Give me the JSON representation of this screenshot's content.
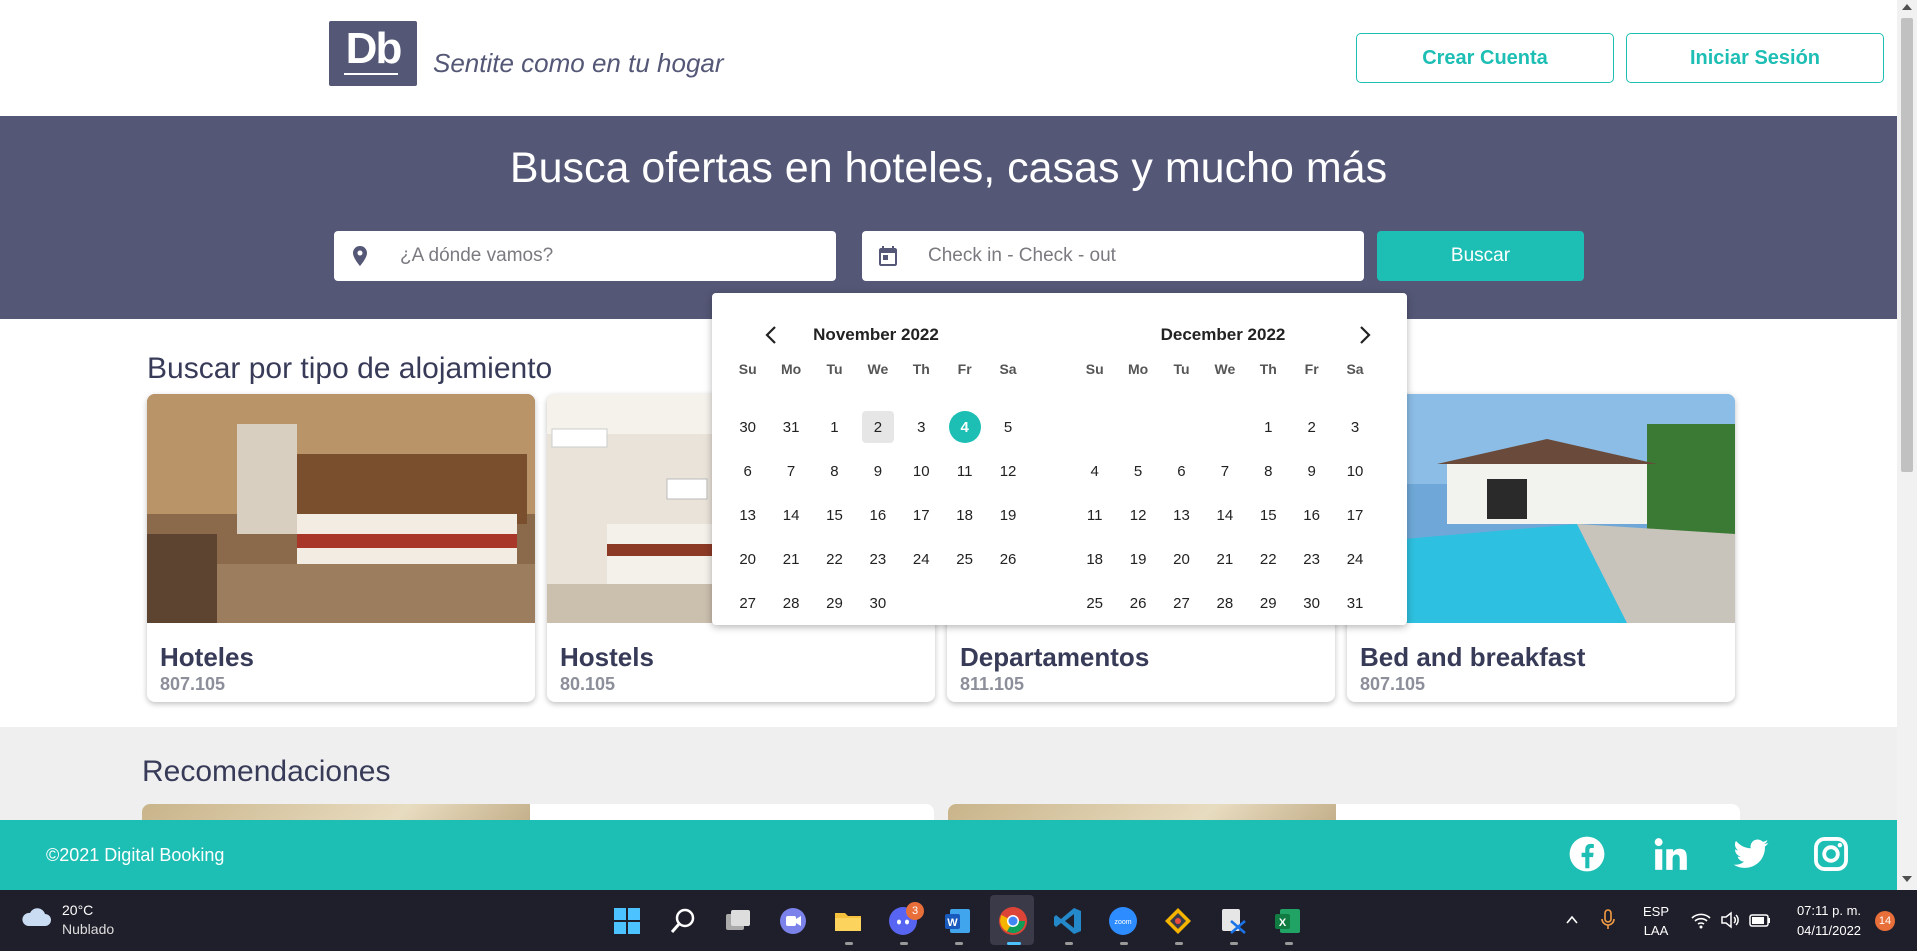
{
  "header": {
    "logo_text": "Db",
    "slogan": "Sentite como en tu hogar",
    "create_account_label": "Crear Cuenta",
    "login_label": "Iniciar Sesión"
  },
  "hero": {
    "title": "Busca ofertas en hoteles, casas y mucho más",
    "destination_placeholder": "¿A dónde vamos?",
    "dates_placeholder": "Check in - Check - out",
    "search_label": "Buscar"
  },
  "calendar": {
    "weekdays": [
      "Su",
      "Mo",
      "Tu",
      "We",
      "Th",
      "Fr",
      "Sa"
    ],
    "months": [
      {
        "title": "November 2022",
        "days": [
          "30",
          "31",
          "1",
          "2",
          "3",
          "4",
          "5",
          "6",
          "7",
          "8",
          "9",
          "10",
          "11",
          "12",
          "13",
          "14",
          "15",
          "16",
          "17",
          "18",
          "19",
          "20",
          "21",
          "22",
          "23",
          "24",
          "25",
          "26",
          "27",
          "28",
          "29",
          "30"
        ],
        "today": "2",
        "selected": "4"
      },
      {
        "title": "December 2022",
        "leading_blanks": 4,
        "days": [
          "1",
          "2",
          "3",
          "4",
          "5",
          "6",
          "7",
          "8",
          "9",
          "10",
          "11",
          "12",
          "13",
          "14",
          "15",
          "16",
          "17",
          "18",
          "19",
          "20",
          "21",
          "22",
          "23",
          "24",
          "25",
          "26",
          "27",
          "28",
          "29",
          "30",
          "31"
        ]
      }
    ]
  },
  "categories": {
    "title": "Buscar por tipo de alojamiento",
    "items": [
      {
        "name": "Hoteles",
        "count": "807.105"
      },
      {
        "name": "Hostels",
        "count": "80.105"
      },
      {
        "name": "Departamentos",
        "count": "811.105"
      },
      {
        "name": "Bed and breakfast",
        "count": "807.105"
      }
    ]
  },
  "recommendations": {
    "title": "Recomendaciones"
  },
  "footer": {
    "copyright": "©2021 Digital Booking",
    "social": [
      "facebook-icon",
      "linkedin-icon",
      "twitter-icon",
      "instagram-icon"
    ]
  },
  "taskbar": {
    "weather_temp": "20°C",
    "weather_condition": "Nublado",
    "language": "ESP",
    "layout": "LAA",
    "time": "07:11 p. m.",
    "date": "04/11/2022",
    "notifications": "14",
    "discord_badge": "3"
  },
  "colors": {
    "primary": "#1DBEB4",
    "secondary": "#545776",
    "text_dark": "#383B58"
  }
}
